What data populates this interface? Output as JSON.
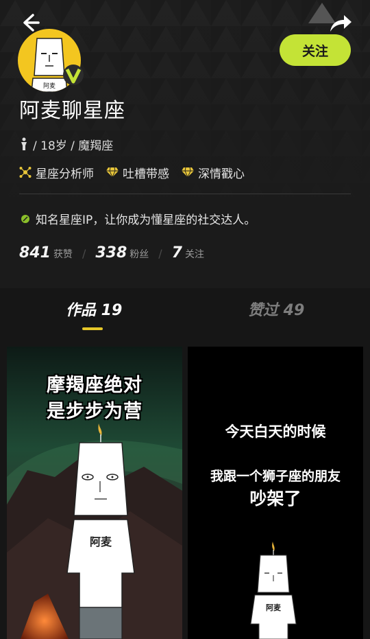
{
  "profile": {
    "name": "阿麦聊星座",
    "info": "/ 18岁 / 魔羯座",
    "avatar_text": "阿麦",
    "follow_label": "关注",
    "tags": [
      {
        "label": "星座分析师",
        "icon": "analyst-icon"
      },
      {
        "label": "吐槽带感",
        "icon": "diamond-icon"
      },
      {
        "label": "深情戳心",
        "icon": "diamond-icon"
      }
    ],
    "bio": "知名星座IP，让你成为懂星座的社交达人。",
    "stats": {
      "likes_num": "841",
      "likes_label": "获赞",
      "fans_num": "338",
      "fans_label": "粉丝",
      "following_num": "7",
      "following_label": "关注"
    }
  },
  "tabs": {
    "works": "作品 19",
    "liked": "赞过 49"
  },
  "cards": [
    {
      "line1": "摩羯座绝对",
      "line2": "是步步为营",
      "shirt_text": "阿麦"
    },
    {
      "line1": "今天白天的时候",
      "line2": "我跟一个狮子座的朋友",
      "line3": "吵架了",
      "shirt_text": "阿麦"
    }
  ],
  "colors": {
    "accent": "#c4e336",
    "tab_underline": "#e6c829",
    "avatar_bg": "#f3c620",
    "background": "#161616"
  }
}
